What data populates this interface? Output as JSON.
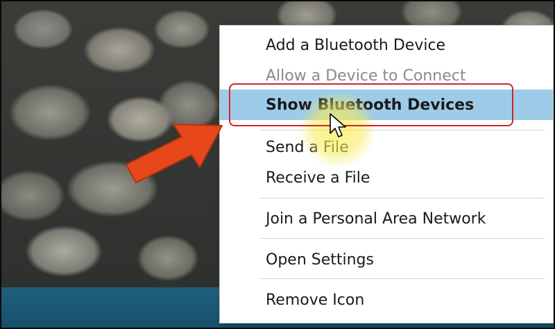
{
  "context_menu": {
    "items": [
      {
        "label": "Add a Bluetooth Device",
        "state": "enabled"
      },
      {
        "label": "Allow a Device to Connect",
        "state": "disabled"
      },
      {
        "label": "Show Bluetooth Devices",
        "state": "highlighted"
      },
      {
        "label": "Send a File",
        "state": "enabled"
      },
      {
        "label": "Receive a File",
        "state": "enabled"
      },
      {
        "label": "Join a Personal Area Network",
        "state": "enabled"
      },
      {
        "label": "Open Settings",
        "state": "enabled"
      },
      {
        "label": "Remove Icon",
        "state": "enabled"
      }
    ]
  },
  "colors": {
    "highlight_background": "#9ecbe8",
    "outline_red": "#d0242b",
    "arrow_orange": "#e8471c",
    "disabled_text": "#8a8a8a",
    "taskbar_blue": "#1e5f7e"
  },
  "icons": {
    "annotation": "arrow-icon",
    "pointer": "mouse-cursor-icon"
  }
}
